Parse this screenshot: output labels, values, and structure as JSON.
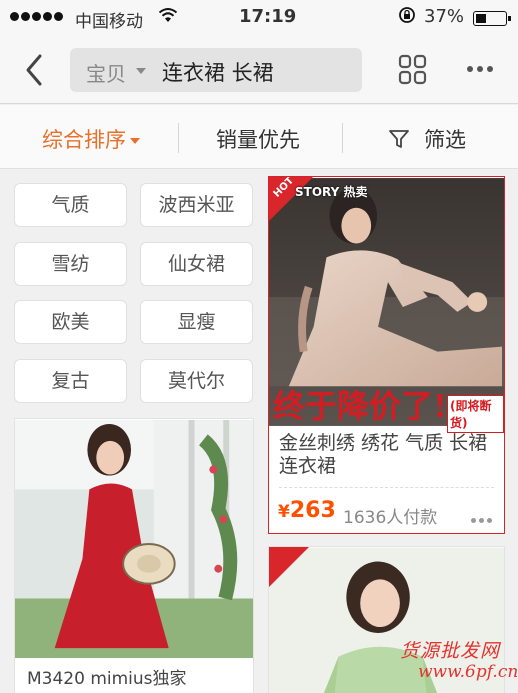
{
  "status_bar": {
    "carrier": "中国移动",
    "time": "17:19",
    "battery": "37%",
    "battery_level": 0.37
  },
  "header": {
    "search_category": "宝贝",
    "search_query": "连衣裙 长裙"
  },
  "sortbar": {
    "default": "综合排序",
    "sales": "销量优先",
    "filter": "筛选",
    "active_color": "#e8702a"
  },
  "tags": [
    "气质",
    "波西米亚",
    "雪纺",
    "仙女裙",
    "欧美",
    "显瘦",
    "复古",
    "莫代尔"
  ],
  "product_main": {
    "story_badge": "STORY 热卖",
    "hot_badge": "HOT",
    "banner": "终于降价了!",
    "banner_note": "(即将断货)",
    "title": "金丝刺绣 绣花 气质 长裙连衣裙",
    "price_symbol": "¥",
    "price": "263",
    "paid_count": "1636人付款",
    "price_color": "#ff5000"
  },
  "product_left": {
    "title": "M3420 mimius独家"
  },
  "watermark": {
    "text": "货源批发网",
    "url": "www.6pf.cn"
  },
  "icons": [
    "back-icon",
    "grid-view-icon",
    "more-icon",
    "filter-funnel-icon",
    "wifi-icon",
    "lock-rotation-icon"
  ]
}
